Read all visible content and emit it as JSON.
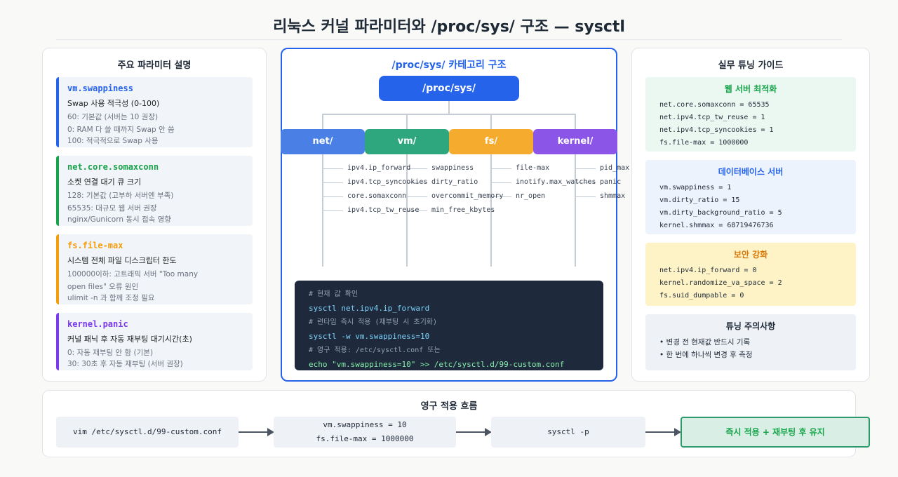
{
  "title": "리눅스 커널 파라미터와 /proc/sys/ 구조 — sysctl",
  "left": {
    "title": "주요 파라미터 설명",
    "cards": [
      {
        "name": "vm.swappiness",
        "color": "#2563eb",
        "desc": "Swap 사용 적극성 (0-100)",
        "lines": [
          "60: 기본값 (서버는 10 권장)",
          "0: RAM 다 쓸 때까지 Swap 안 씀",
          "100: 적극적으로 Swap 사용"
        ]
      },
      {
        "name": "net.core.somaxconn",
        "color": "#16a34a",
        "desc": "소켓 연결 대기 큐 크기",
        "lines": [
          "128: 기본값 (고부하 서버엔 부족)",
          "65535: 대규모 웹 서버 권장",
          "nginx/Gunicorn 동시 접속 영향"
        ]
      },
      {
        "name": "fs.file-max",
        "color": "#f59e0b",
        "desc": "시스템 전체 파일 디스크립터 한도",
        "lines": [
          "100000이하: 고트래픽 서버 \"Too many",
          "open files\" 오류 원인",
          "ulimit -n 과 함께 조정 필요"
        ]
      },
      {
        "name": "kernel.panic",
        "color": "#7c3aed",
        "desc": "커널 패닉 후 자동 재부팅 대기시간(초)",
        "lines": [
          "0: 자동 재부팅 안 함 (기본)",
          "30: 30초 후 자동 재부팅 (서버 권장)"
        ]
      }
    ]
  },
  "center": {
    "title": "/proc/sys/ 카테고리 구조",
    "root": "/proc/sys/",
    "categories": [
      {
        "label": "net/",
        "color": "#4a7fe6",
        "items": [
          "ipv4.ip_forward",
          "ipv4.tcp_syncookies",
          "core.somaxconn",
          "ipv4.tcp_tw_reuse"
        ]
      },
      {
        "label": "vm/",
        "color": "#2ea77e",
        "items": [
          "swappiness",
          "dirty_ratio",
          "overcommit_memory",
          "min_free_kbytes"
        ]
      },
      {
        "label": "fs/",
        "color": "#f5ab2e",
        "items": [
          "file-max",
          "inotify.max_watches",
          "nr_open"
        ]
      },
      {
        "label": "kernel/",
        "color": "#8b55e8",
        "items": [
          "pid_max",
          "panic",
          "shmmax"
        ]
      }
    ],
    "terminal": [
      {
        "type": "comment",
        "text": "# 현재 값 확인"
      },
      {
        "type": "cmd",
        "text": "sysctl net.ipv4.ip_forward"
      },
      {
        "type": "comment",
        "text": "# 런타임 즉시 적용 (재부팅 시 초기화)"
      },
      {
        "type": "cmd",
        "text": "sysctl -w vm.swappiness=10"
      },
      {
        "type": "comment",
        "text": "# 영구 적용: /etc/sysctl.conf 또는"
      },
      {
        "type": "cmd-green",
        "text": "echo \"vm.swappiness=10\" >> /etc/sysctl.d/99-custom.conf"
      }
    ]
  },
  "right": {
    "title": "실무 튜닝 가이드",
    "cards": [
      {
        "title": "웹 서버 최적화",
        "title_color": "#16a34a",
        "bg": "#eaf8f1",
        "lines": [
          "net.core.somaxconn = 65535",
          "net.ipv4.tcp_tw_reuse = 1",
          "net.ipv4.tcp_syncookies = 1",
          "fs.file-max = 1000000"
        ]
      },
      {
        "title": "데이터베이스 서버",
        "title_color": "#2563eb",
        "bg": "#ecf3fd",
        "lines": [
          "vm.swappiness = 1",
          "vm.dirty_ratio = 15",
          "vm.dirty_background_ratio = 5",
          "kernel.shmmax = 68719476736"
        ]
      },
      {
        "title": "보안 강화",
        "title_color": "#d97706",
        "bg": "#fef3c7",
        "lines": [
          "net.ipv4.ip_forward = 0",
          "kernel.randomize_va_space = 2",
          "fs.suid_dumpable = 0"
        ]
      },
      {
        "title": "튜닝 주의사항",
        "title_color": "#1f2937",
        "bg": "#eef1f5",
        "notes": [
          "• 변경 전 현재값 반드시 기록",
          "• 한 번에 하나씩 변경 후 측정"
        ]
      }
    ]
  },
  "flow": {
    "title": "영구 적용 흐름",
    "step1": "vim /etc/sysctl.d/99-custom.conf",
    "step2": [
      "vm.swappiness = 10",
      "fs.file-max = 1000000"
    ],
    "step3": "sysctl -p",
    "final": "즉시 적용 + 재부팅 후 유지"
  }
}
